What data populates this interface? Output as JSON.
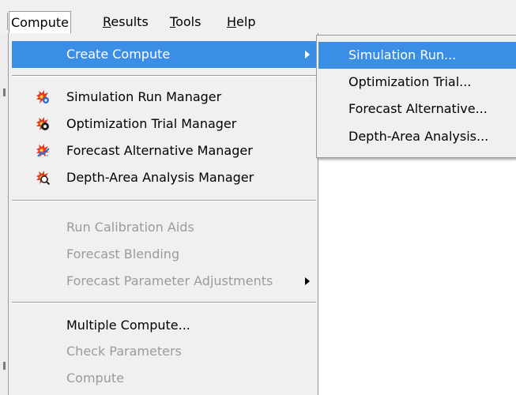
{
  "menubar": {
    "items": [
      {
        "label": "Compute",
        "underline": "",
        "rest": "Compute"
      },
      {
        "label": "Results",
        "underline": "R",
        "rest": "esults"
      },
      {
        "label": "Tools",
        "underline": "T",
        "rest": "ools"
      },
      {
        "label": "Help",
        "underline": "H",
        "rest": "elp"
      }
    ]
  },
  "menu": {
    "create_compute": "Create Compute",
    "managers": [
      {
        "label": "Simulation Run Manager",
        "icon": "simulation-run-manager-icon"
      },
      {
        "label": "Optimization Trial Manager",
        "icon": "optimization-trial-manager-icon"
      },
      {
        "label": "Forecast Alternative Manager",
        "icon": "forecast-alternative-manager-icon"
      },
      {
        "label": "Depth-Area Analysis Manager",
        "icon": "depth-area-analysis-manager-icon"
      }
    ],
    "disabled_group": [
      {
        "label": "Run Calibration Aids"
      },
      {
        "label": "Forecast Blending"
      },
      {
        "label": "Forecast Parameter Adjustments"
      }
    ],
    "bottom_group": [
      {
        "label": "Multiple Compute...",
        "enabled": true
      },
      {
        "label": "Check Parameters",
        "enabled": false
      },
      {
        "label": "Compute",
        "enabled": false
      }
    ]
  },
  "submenu": {
    "items": [
      {
        "label": "Simulation Run..."
      },
      {
        "label": "Optimization Trial..."
      },
      {
        "label": "Forecast Alternative..."
      },
      {
        "label": "Depth-Area Analysis..."
      }
    ]
  },
  "colors": {
    "highlight": "#3b8ee6",
    "menu_bg": "#f0f0f0",
    "disabled_text": "#9b9b9b"
  }
}
